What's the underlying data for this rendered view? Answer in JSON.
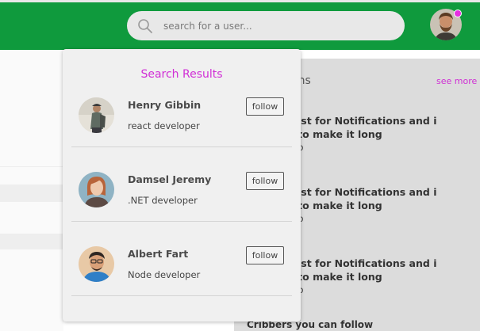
{
  "header": {
    "search_placeholder": "search for a user...",
    "brand_color": "#0f9a3d",
    "notification_dot_color": "#e62fe0"
  },
  "search_results": {
    "title": "Search Results",
    "users": [
      {
        "name": "Henry Gibbin",
        "role": "react developer",
        "follow_label": "follow"
      },
      {
        "name": "Damsel Jeremy",
        "role": ".NET developer",
        "follow_label": "follow"
      },
      {
        "name": "Albert Fart",
        "role": "Node developer",
        "follow_label": "follow"
      }
    ]
  },
  "notifications": {
    "title_partial": "ons",
    "see_more": "see more",
    "items": [
      {
        "line1": "his is a test for Notifications and i",
        "line2": "m trying to make it long",
        "time": "minutes ago"
      },
      {
        "line1": "his is a test for Notifications and i",
        "line2": "m trying to make it long",
        "time": "minutes ago"
      },
      {
        "line1": "his is a test for Notifications and i",
        "line2": "m trying to make it long",
        "time": "minutes ago"
      }
    ],
    "footer": "Cribbers you can follow"
  }
}
